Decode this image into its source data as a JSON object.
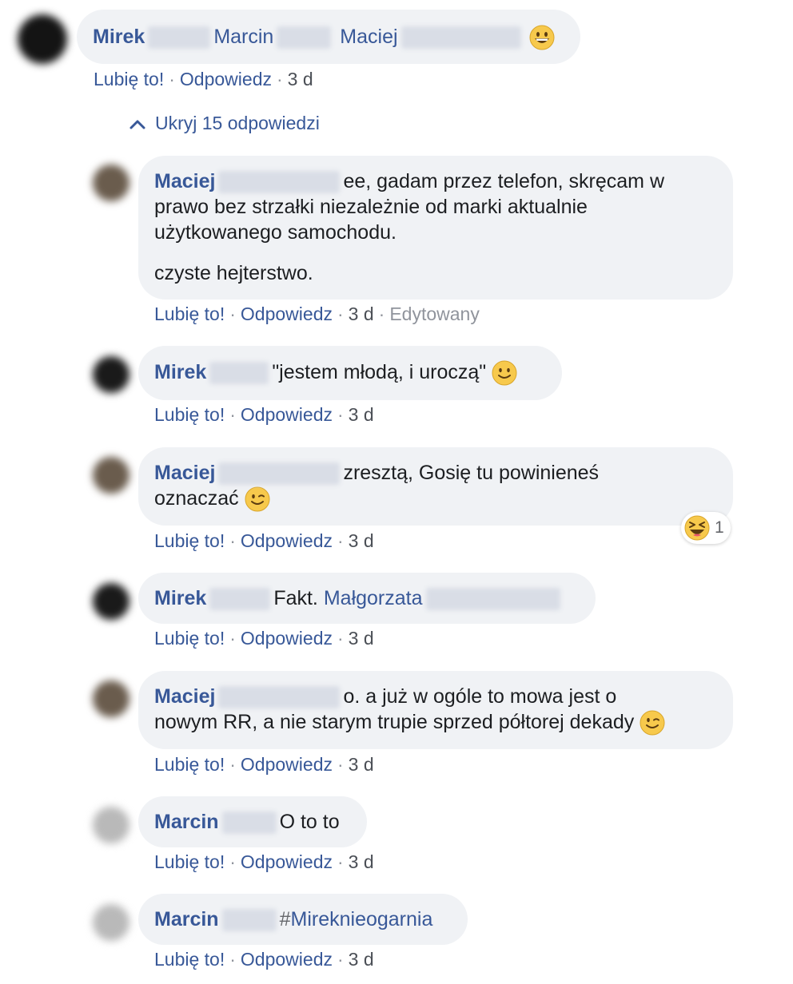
{
  "top_comment": {
    "names": [
      "Mirek",
      "Marcin",
      "Maciej"
    ],
    "emoji": "grinning-face-icon",
    "actions": {
      "like": "Lubię to!",
      "reply": "Odpowiedz",
      "time": "3 d"
    }
  },
  "hide_replies": "Ukryj 15 odpowiedzi",
  "separator": "·",
  "replies": [
    {
      "author": "Maciej",
      "lines": [
        "ee, gadam przez telefon, skręcam w",
        "prawo bez strzałki niezależnie od marki aktualnie",
        "użytkowanego samochodu."
      ],
      "paragraph2": "czyste hejterstwo.",
      "actions": {
        "like": "Lubię to!",
        "reply": "Odpowiedz",
        "time": "3 d",
        "edited": "Edytowany"
      }
    },
    {
      "author": "Mirek",
      "text": "\"jestem młodą, i uroczą\"",
      "emoji": "slightly-smiling-face-icon",
      "actions": {
        "like": "Lubię to!",
        "reply": "Odpowiedz",
        "time": "3 d"
      }
    },
    {
      "author": "Maciej",
      "line1": "zresztą, Gosię tu powinieneś",
      "line2": "oznaczać",
      "emoji": "winking-face-icon",
      "reaction": {
        "icon": "laughing-squinting-face-icon",
        "count": "1"
      },
      "actions": {
        "like": "Lubię to!",
        "reply": "Odpowiedz",
        "time": "3 d"
      }
    },
    {
      "author": "Mirek",
      "text": "Fakt.",
      "mention": "Małgorzata",
      "actions": {
        "like": "Lubię to!",
        "reply": "Odpowiedz",
        "time": "3 d"
      }
    },
    {
      "author": "Maciej",
      "line1": "o. a już w ogóle to mowa jest o",
      "line2": "nowym RR, a nie starym trupie sprzed półtorej dekady",
      "emoji": "winking-face-icon",
      "actions": {
        "like": "Lubię to!",
        "reply": "Odpowiedz",
        "time": "3 d"
      }
    },
    {
      "author": "Marcin",
      "text": "O to to",
      "actions": {
        "like": "Lubię to!",
        "reply": "Odpowiedz",
        "time": "3 d"
      }
    },
    {
      "author": "Marcin",
      "hash": "#",
      "hashtag": "Mireknieogarnia",
      "actions": {
        "like": "Lubię to!",
        "reply": "Odpowiedz",
        "time": "3 d"
      }
    }
  ],
  "colors": {
    "link": "#385898",
    "bubble": "#f0f2f5",
    "meta": "#90949c",
    "text": "#1c1e21"
  }
}
